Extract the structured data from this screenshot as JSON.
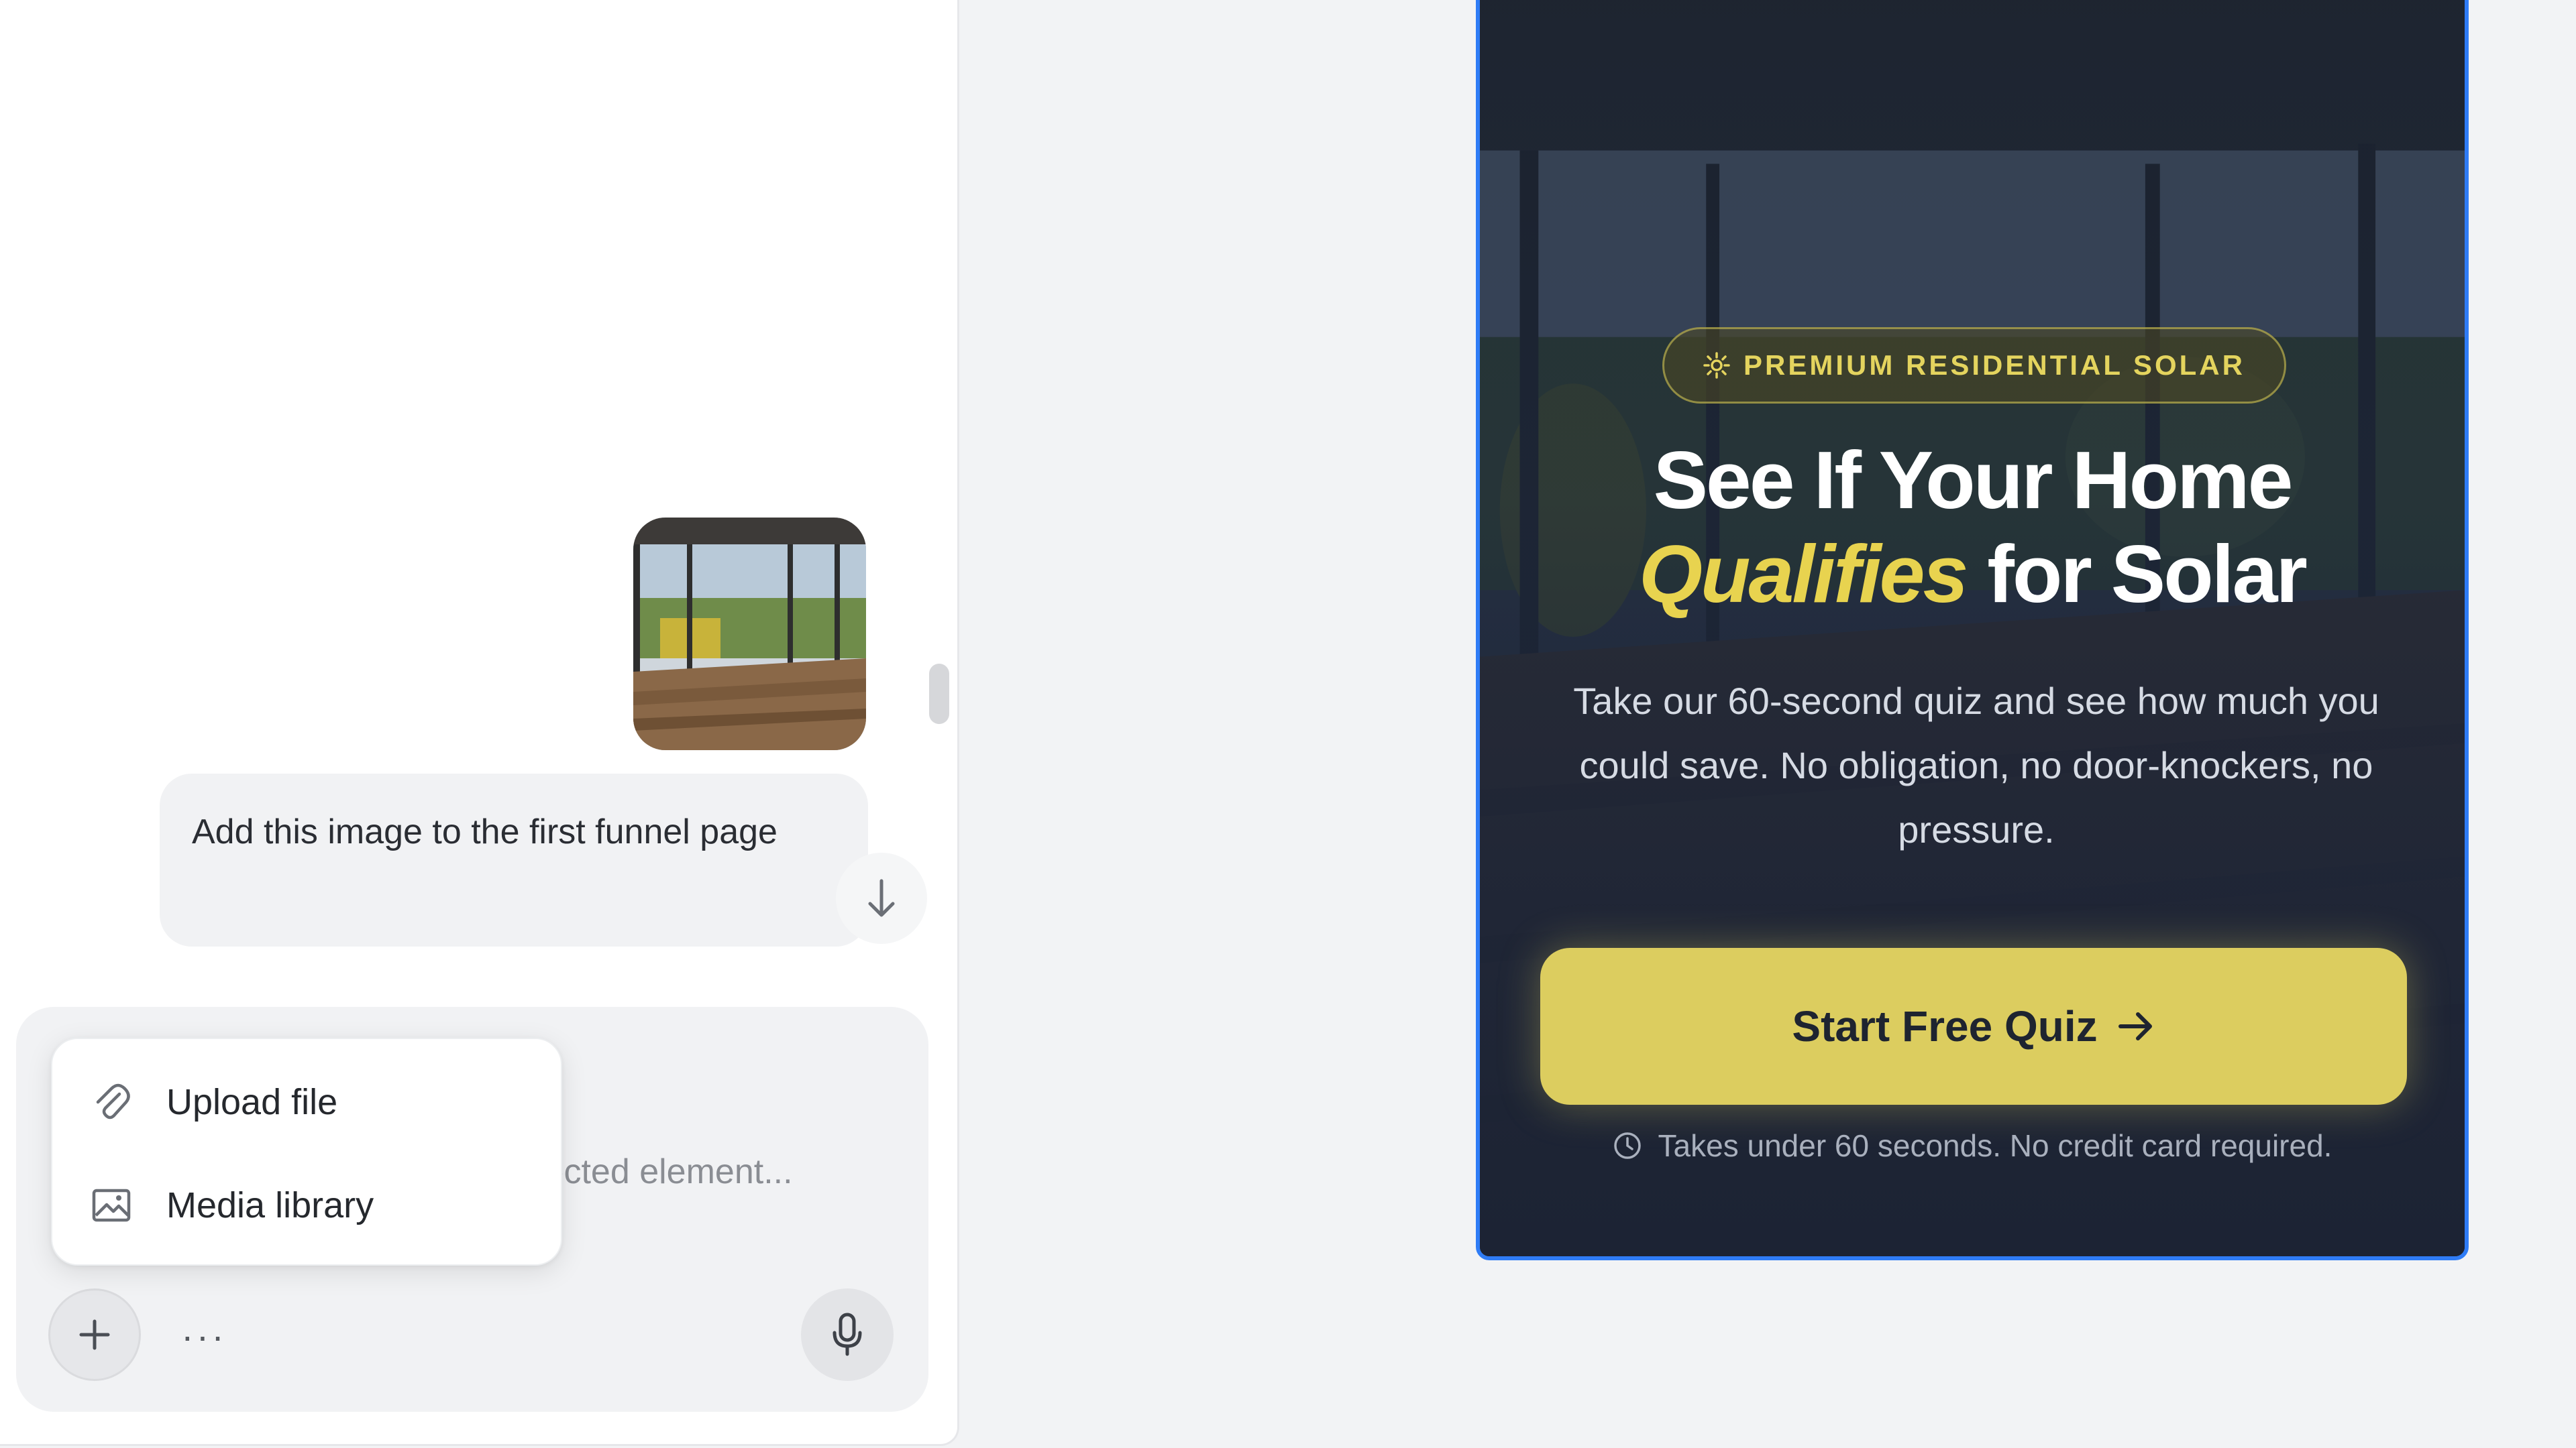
{
  "chat": {
    "message_text": "Add this image to the first funnel page",
    "composer_placeholder": "lected element...",
    "more_label": "···",
    "attach_menu": {
      "items": [
        {
          "label": "Upload file",
          "icon": "paperclip-icon"
        },
        {
          "label": "Media library",
          "icon": "image-icon"
        }
      ]
    }
  },
  "preview": {
    "badge": "PREMIUM RESIDENTIAL SOLAR",
    "headline_line1": "See If Your Home",
    "headline_accent": "Qualifies",
    "headline_rest": "for Solar",
    "subtext": "Take our 60-second quiz and see how much you could save. No obligation, no door-knockers, no pressure.",
    "cta_label": "Start Free Quiz",
    "cta_icon": "arrow-right-icon",
    "footnote": "Takes under 60 seconds. No credit card required.",
    "colors": {
      "accent_yellow": "#dccd5f",
      "selection_blue": "#2f7cf6",
      "overlay_navy": "#1c2638"
    }
  }
}
